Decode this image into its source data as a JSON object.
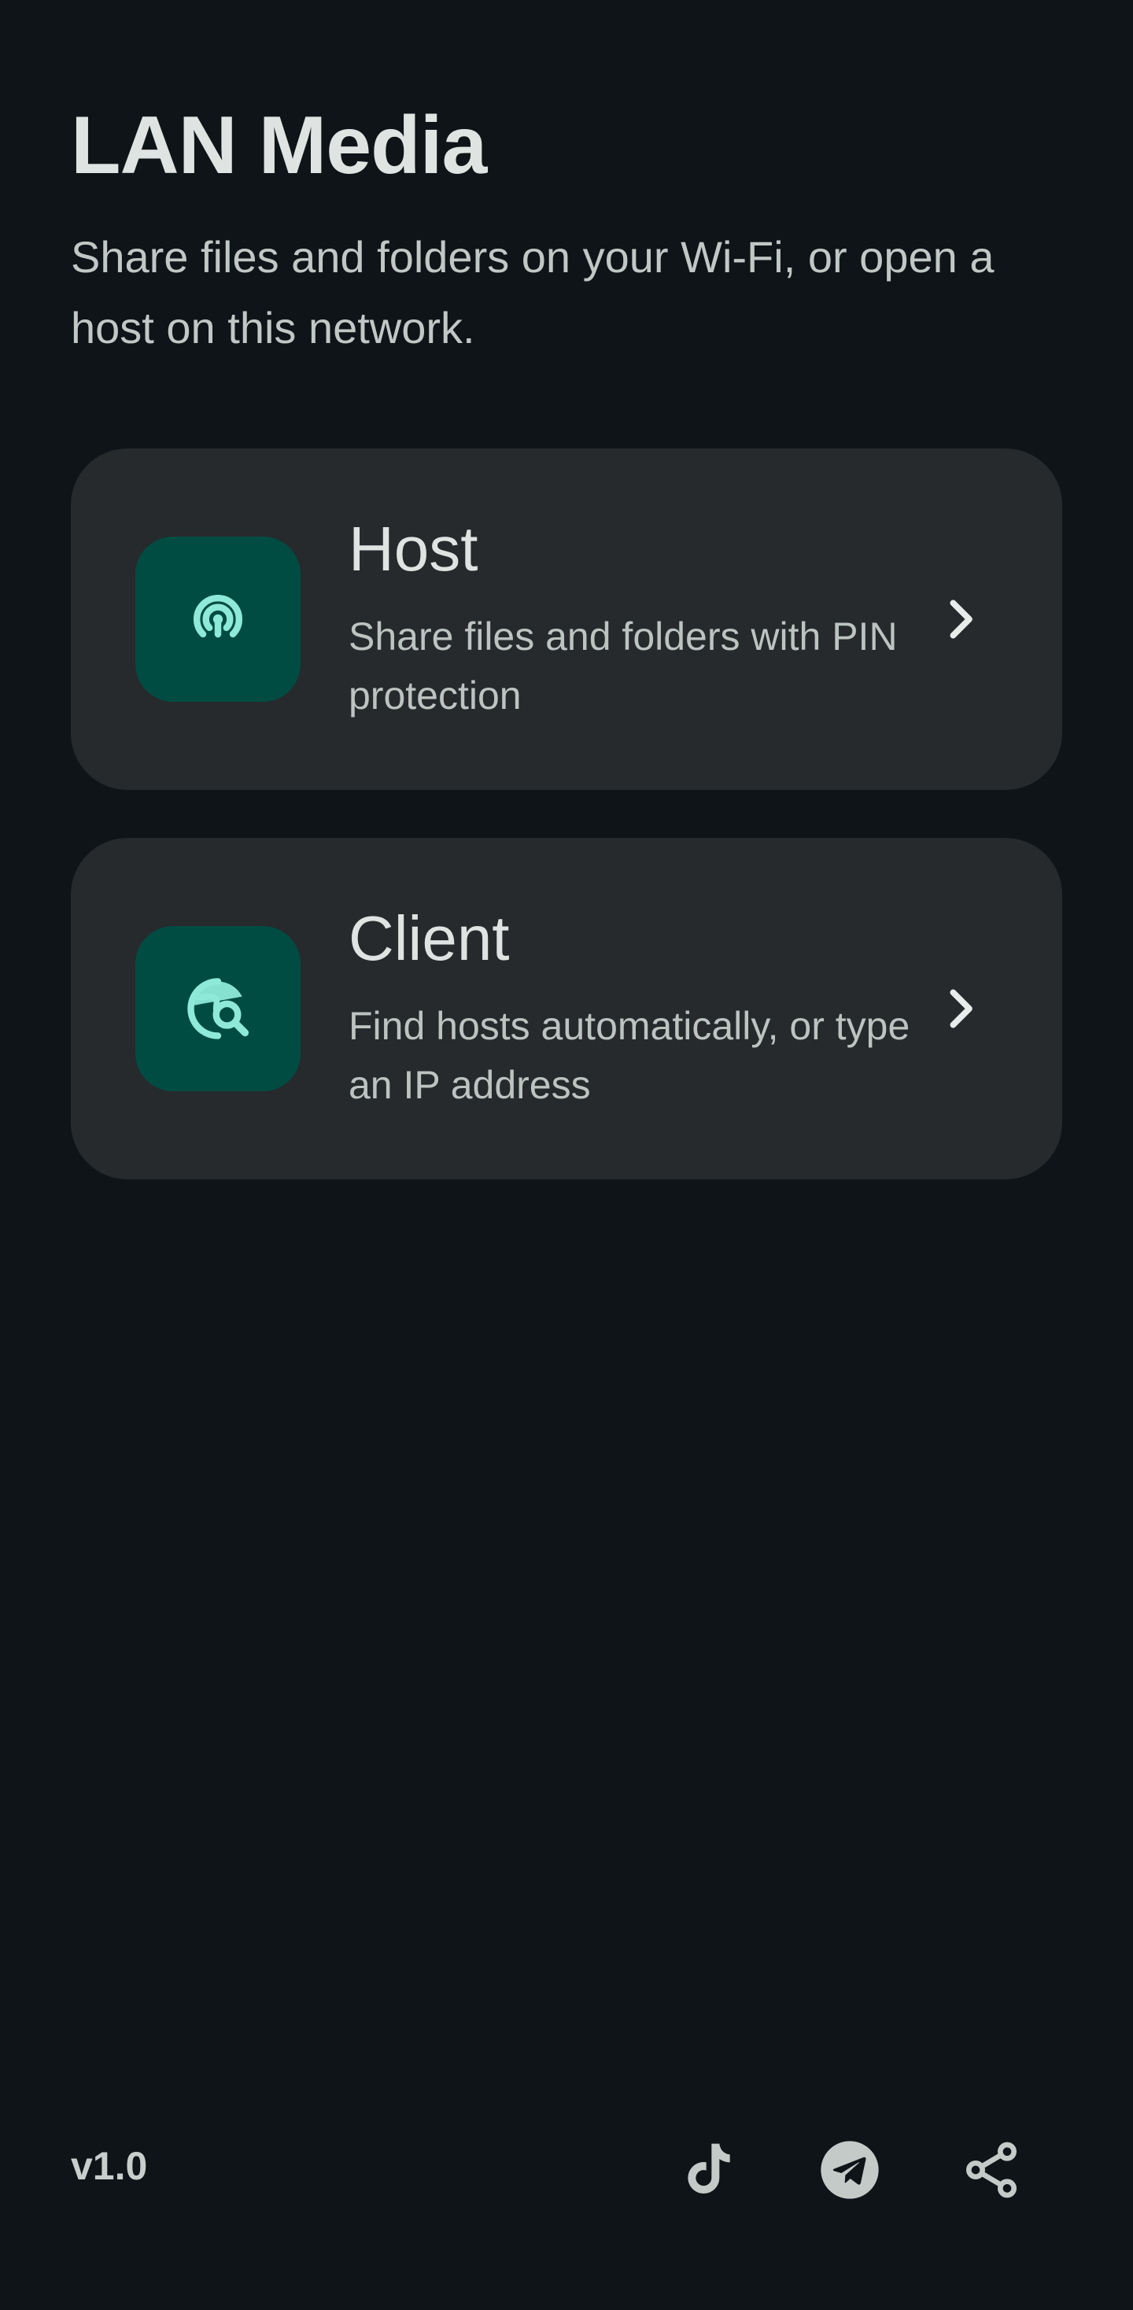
{
  "header": {
    "title": "LAN Media",
    "subtitle": "Share files and folders on your Wi-Fi, or open a host on this network."
  },
  "cards": [
    {
      "title": "Host",
      "description": "Share files and folders with PIN protection",
      "icon": "broadcast-icon"
    },
    {
      "title": "Client",
      "description": "Find hosts automatically, or type an IP address",
      "icon": "network-search-icon"
    }
  ],
  "footer": {
    "version": "v1.0",
    "icons": [
      "tiktok-icon",
      "telegram-icon",
      "share-icon"
    ]
  },
  "colors": {
    "background": "#0f1418",
    "card": "#262a2c",
    "icon_tile": "#004c43",
    "icon_accent": "#8ee9d8",
    "text_primary": "#dfe3e1",
    "text_secondary": "#bcc3c1"
  }
}
